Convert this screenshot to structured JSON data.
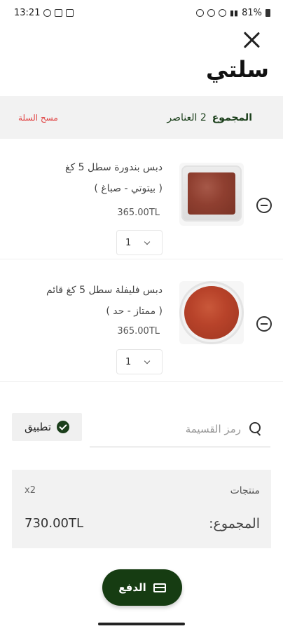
{
  "status_bar": {
    "time": "13:21",
    "battery": "81%"
  },
  "header": {
    "title": "سلتي",
    "close_icon": "close-icon"
  },
  "summary": {
    "total_label": "المجموع",
    "items_count": "2 العناصر",
    "clear_label": "مسح السلة"
  },
  "items": [
    {
      "name_line1": "دبس بندورة سطل 5 كغ",
      "name_line2": "( بيتوتي - صباغ )",
      "price": "365.00TL",
      "quantity": "1",
      "image": "tomato-paste-tub"
    },
    {
      "name_line1": "دبس فليفلة سطل 5 كغ قائم",
      "name_line2": "( ممتاز - حد )",
      "price": "365.00TL",
      "quantity": "1",
      "image": "pepper-paste-bowl"
    }
  ],
  "coupon": {
    "placeholder": "رمز القسيمة",
    "apply_label": "تطبيق"
  },
  "totals": {
    "products_label": "منتجات",
    "products_count": "x2",
    "total_label": "المجموع:",
    "total_value": "730.00TL"
  },
  "checkout": {
    "label": "الدفع"
  },
  "colors": {
    "brand_green": "#163c12",
    "danger_red": "#e04545"
  }
}
